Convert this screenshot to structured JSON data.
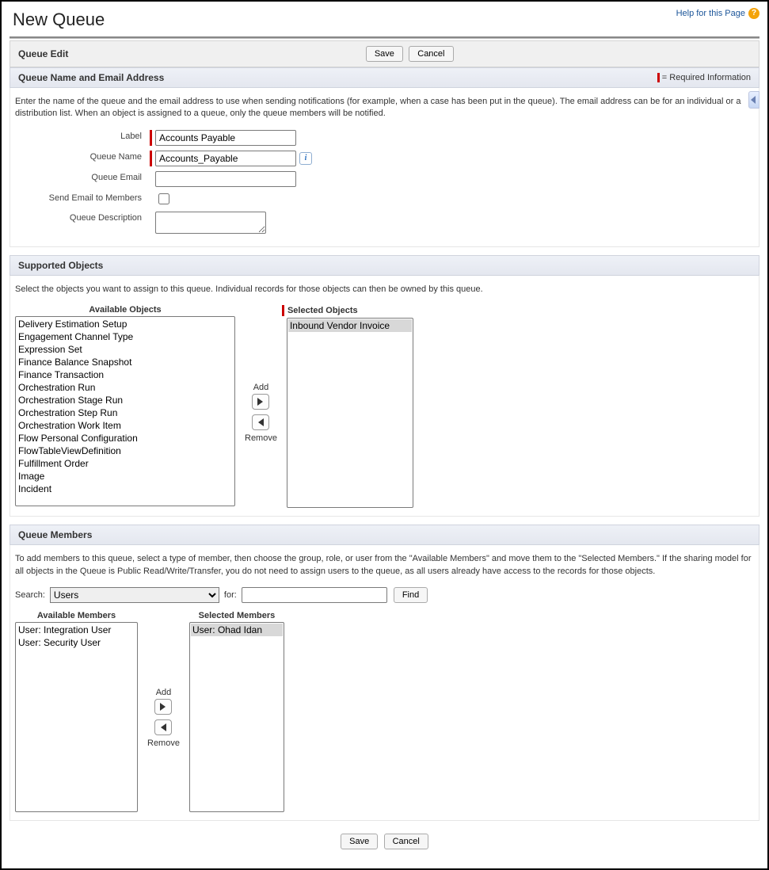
{
  "page": {
    "title": "New Queue",
    "help_link": "Help for this Page"
  },
  "buttons": {
    "save": "Save",
    "cancel": "Cancel",
    "add": "Add",
    "remove": "Remove",
    "find": "Find"
  },
  "sections": {
    "queue_edit": "Queue Edit",
    "name_email": "Queue Name and Email Address",
    "supported_objects": "Supported Objects",
    "queue_members": "Queue Members",
    "required_info": "= Required Information"
  },
  "name_email": {
    "description": "Enter the name of the queue and the email address to use when sending notifications (for example, when a case has been put in the queue). The email address can be for an individual or a distribution list. When an object is assigned to a queue, only the queue members will be notified.",
    "labels": {
      "label": "Label",
      "queue_name": "Queue Name",
      "queue_email": "Queue Email",
      "send_email": "Send Email to Members",
      "description": "Queue Description"
    },
    "values": {
      "label": "Accounts Payable",
      "queue_name": "Accounts_Payable",
      "queue_email": "",
      "send_email_checked": false,
      "description": ""
    }
  },
  "supported_objects": {
    "description": "Select the objects you want to assign to this queue. Individual records for those objects can then be owned by this queue.",
    "available_title": "Available Objects",
    "selected_title": "Selected Objects",
    "available": [
      "Delivery Estimation Setup",
      "Engagement Channel Type",
      "Expression Set",
      "Finance Balance Snapshot",
      "Finance Transaction",
      "Orchestration Run",
      "Orchestration Stage Run",
      "Orchestration Step Run",
      "Orchestration Work Item",
      "Flow Personal Configuration",
      "FlowTableViewDefinition",
      "Fulfillment Order",
      "Image",
      "Incident"
    ],
    "selected": [
      "Inbound Vendor Invoice"
    ]
  },
  "queue_members": {
    "description": "To add members to this queue, select a type of member, then choose the group, role, or user from the \"Available Members\" and move them to the \"Selected Members.\" If the sharing model for all objects in the Queue is Public Read/Write/Transfer, you do not need to assign users to the queue, as all users already have access to the records for those objects.",
    "search_label": "Search:",
    "for_label": "for:",
    "search_type": "Users",
    "search_value": "",
    "available_title": "Available Members",
    "selected_title": "Selected Members",
    "available": [
      "User: Integration User",
      "User: Security User"
    ],
    "selected": [
      "User: Ohad Idan"
    ]
  }
}
